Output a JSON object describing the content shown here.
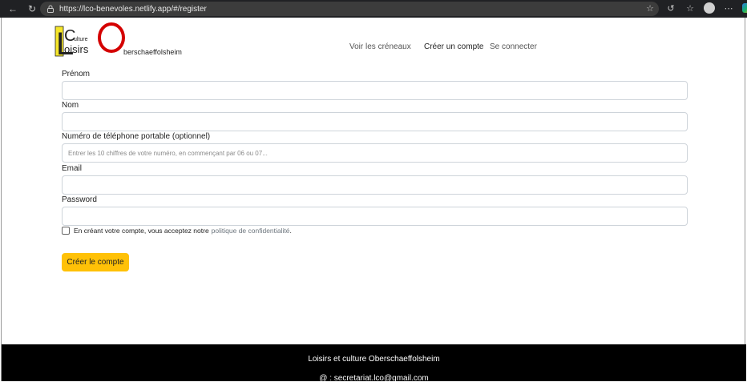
{
  "browser": {
    "url": "https://lco-benevoles.netlify.app/#/register"
  },
  "logo": {
    "letter_l": "L",
    "letter_c": "C",
    "letter_o": "O",
    "word_culture": "ulture",
    "word_loisirs": "oisirs",
    "word_place": "berschaeffolsheim",
    "colors": {
      "yellow": "#f5e52a",
      "red": "#d40000",
      "dark": "#222222"
    }
  },
  "nav": {
    "slots": "Voir les créneaux",
    "create_account": "Créer un compte",
    "login": "Se connecter"
  },
  "form": {
    "firstname_label": "Prénom",
    "firstname_value": "",
    "lastname_label": "Nom",
    "lastname_value": "",
    "phone_label": "Numéro de téléphone portable (optionnel)",
    "phone_placeholder": "Entrer les 10 chiffres de votre numéro, en commençant par 06 ou 07...",
    "email_label": "Email",
    "email_value": "",
    "password_label": "Password",
    "password_value": "",
    "consent_text": "En créant votre compte, vous acceptez notre",
    "consent_link": "politique de confidentialité",
    "consent_end": ".",
    "consent_checked": false,
    "submit_label": "Créer le compte",
    "accent": "#ffc107"
  },
  "footer": {
    "title": "Loisirs et culture Oberschaeffolsheim",
    "email": "@ : secretariat.lco@gmail.com"
  }
}
